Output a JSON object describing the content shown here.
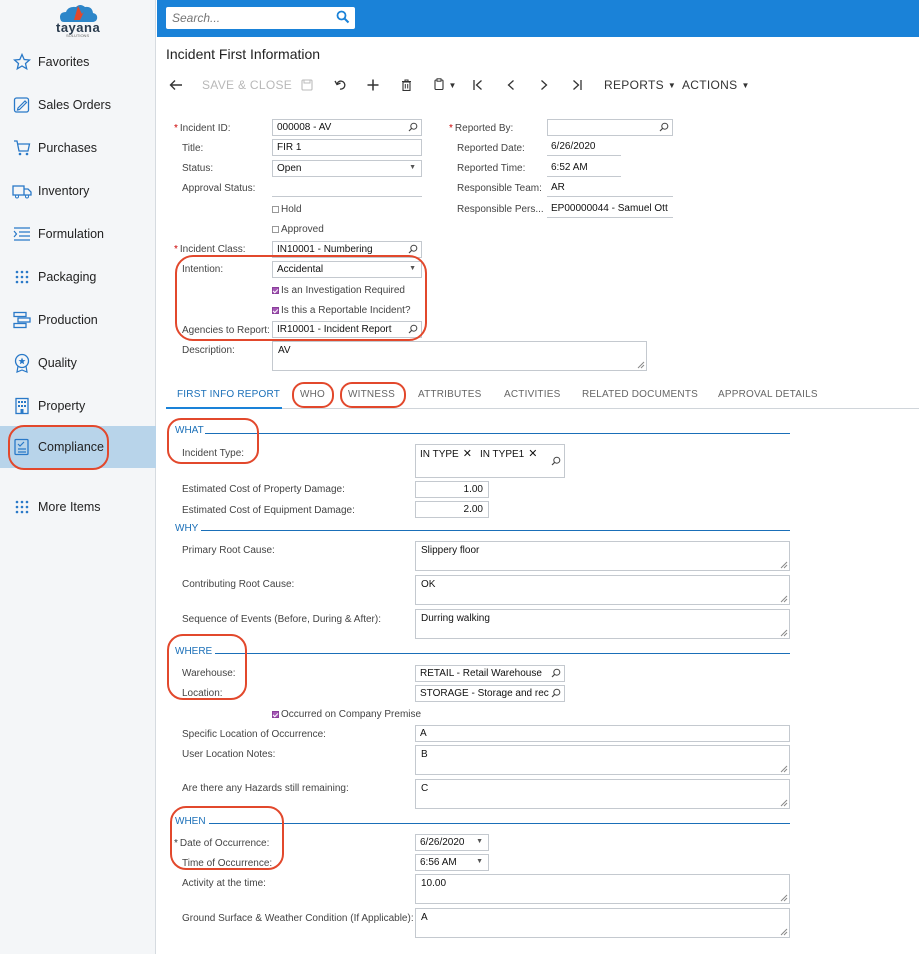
{
  "brand": {
    "name": "tayana",
    "tagline": "SOLUTIONS"
  },
  "sidebar": {
    "items": [
      {
        "label": "Favorites",
        "icon": "star-icon"
      },
      {
        "label": "Sales Orders",
        "icon": "pencil-square-icon"
      },
      {
        "label": "Purchases",
        "icon": "cart-icon"
      },
      {
        "label": "Inventory",
        "icon": "truck-icon"
      },
      {
        "label": "Formulation",
        "icon": "list-icon"
      },
      {
        "label": "Packaging",
        "icon": "dot-grid-icon"
      },
      {
        "label": "Production",
        "icon": "stack-icon"
      },
      {
        "label": "Quality",
        "icon": "badge-icon"
      },
      {
        "label": "Property",
        "icon": "building-icon"
      },
      {
        "label": "Compliance",
        "icon": "checklist-icon",
        "active": true
      },
      {
        "label": "More Items",
        "icon": "dot-grid-icon"
      }
    ]
  },
  "search": {
    "placeholder": "Search..."
  },
  "page": {
    "title": "Incident First Information"
  },
  "toolbar": {
    "save_close": "SAVE & CLOSE",
    "reports": "REPORTS",
    "actions": "ACTIONS"
  },
  "header_form": {
    "incident_id": {
      "label": "Incident ID:",
      "value": "000008 - AV"
    },
    "title": {
      "label": "Title:",
      "value": "FIR 1"
    },
    "status": {
      "label": "Status:",
      "value": "Open"
    },
    "approval_status": {
      "label": "Approval Status:",
      "value": ""
    },
    "hold": {
      "label": "Hold",
      "checked": false
    },
    "approved": {
      "label": "Approved",
      "checked": false
    },
    "incident_class": {
      "label": "Incident Class:",
      "value": "IN10001 - Numbering"
    },
    "intention": {
      "label": "Intention:",
      "value": "Accidental"
    },
    "investigation_required": {
      "label": "Is an Investigation Required",
      "checked": true
    },
    "reportable_incident": {
      "label": "Is this a Reportable Incident?",
      "checked": true
    },
    "agencies_to_report": {
      "label": "Agencies to Report:",
      "value": "IR10001 - Incident Report"
    },
    "description": {
      "label": "Description:",
      "value": "AV"
    },
    "reported_by": {
      "label": "Reported By:",
      "value": ""
    },
    "reported_date": {
      "label": "Reported Date:",
      "value": "6/26/2020"
    },
    "reported_time": {
      "label": "Reported Time:",
      "value": "6:52 AM"
    },
    "responsible_team": {
      "label": "Responsible Team:",
      "value": "AR"
    },
    "responsible_person": {
      "label": "Responsible Pers...",
      "value": "EP00000044 - Samuel Ott"
    }
  },
  "tabs": [
    {
      "label": "FIRST INFO REPORT",
      "active": true
    },
    {
      "label": "WHO"
    },
    {
      "label": "WITNESS"
    },
    {
      "label": "ATTRIBUTES"
    },
    {
      "label": "ACTIVITIES"
    },
    {
      "label": "RELATED DOCUMENTS"
    },
    {
      "label": "APPROVAL DETAILS"
    }
  ],
  "what": {
    "header": "WHAT",
    "incident_type": {
      "label": "Incident Type:",
      "chips": [
        "IN TYPE",
        "IN TYPE1"
      ]
    },
    "property_damage": {
      "label": "Estimated Cost of Property Damage:",
      "value": "1.00"
    },
    "equipment_damage": {
      "label": "Estimated Cost of Equipment Damage:",
      "value": "2.00"
    }
  },
  "why": {
    "header": "WHY",
    "primary_root_cause": {
      "label": "Primary Root Cause:",
      "value": "Slippery floor"
    },
    "contributing_root_cause": {
      "label": "Contributing Root Cause:",
      "value": "OK"
    },
    "sequence_of_events": {
      "label": "Sequence of Events (Before, During & After):",
      "value": "Durring walking"
    }
  },
  "where": {
    "header": "WHERE",
    "warehouse": {
      "label": "Warehouse:",
      "value": "RETAIL - Retail Warehouse"
    },
    "location": {
      "label": "Location:",
      "value": "STORAGE - Storage and rec"
    },
    "company_premise": {
      "label": "Occurred on Company Premise",
      "checked": true
    },
    "specific_location": {
      "label": "Specific Location of Occurrence:",
      "value": "A"
    },
    "user_location_notes": {
      "label": "User Location Notes:",
      "value": "B"
    },
    "hazards_remaining": {
      "label": "Are there any Hazards still remaining:",
      "value": "C"
    }
  },
  "when": {
    "header": "WHEN",
    "date_of_occurrence": {
      "label": "Date of Occurrence:",
      "value": "6/26/2020"
    },
    "time_of_occurrence": {
      "label": "Time of Occurrence:",
      "value": "6:56 AM"
    },
    "activity_at_time": {
      "label": "Activity at the time:",
      "value": "10.00"
    },
    "ground_surface": {
      "label": "Ground Surface & Weather Condition (If Applicable):",
      "value": "A"
    }
  },
  "colors": {
    "accent": "#1a82d8",
    "highlight": "#e2482c",
    "sidebar_active": "#b8d4ea",
    "checkbox_on": "#a457b5"
  }
}
